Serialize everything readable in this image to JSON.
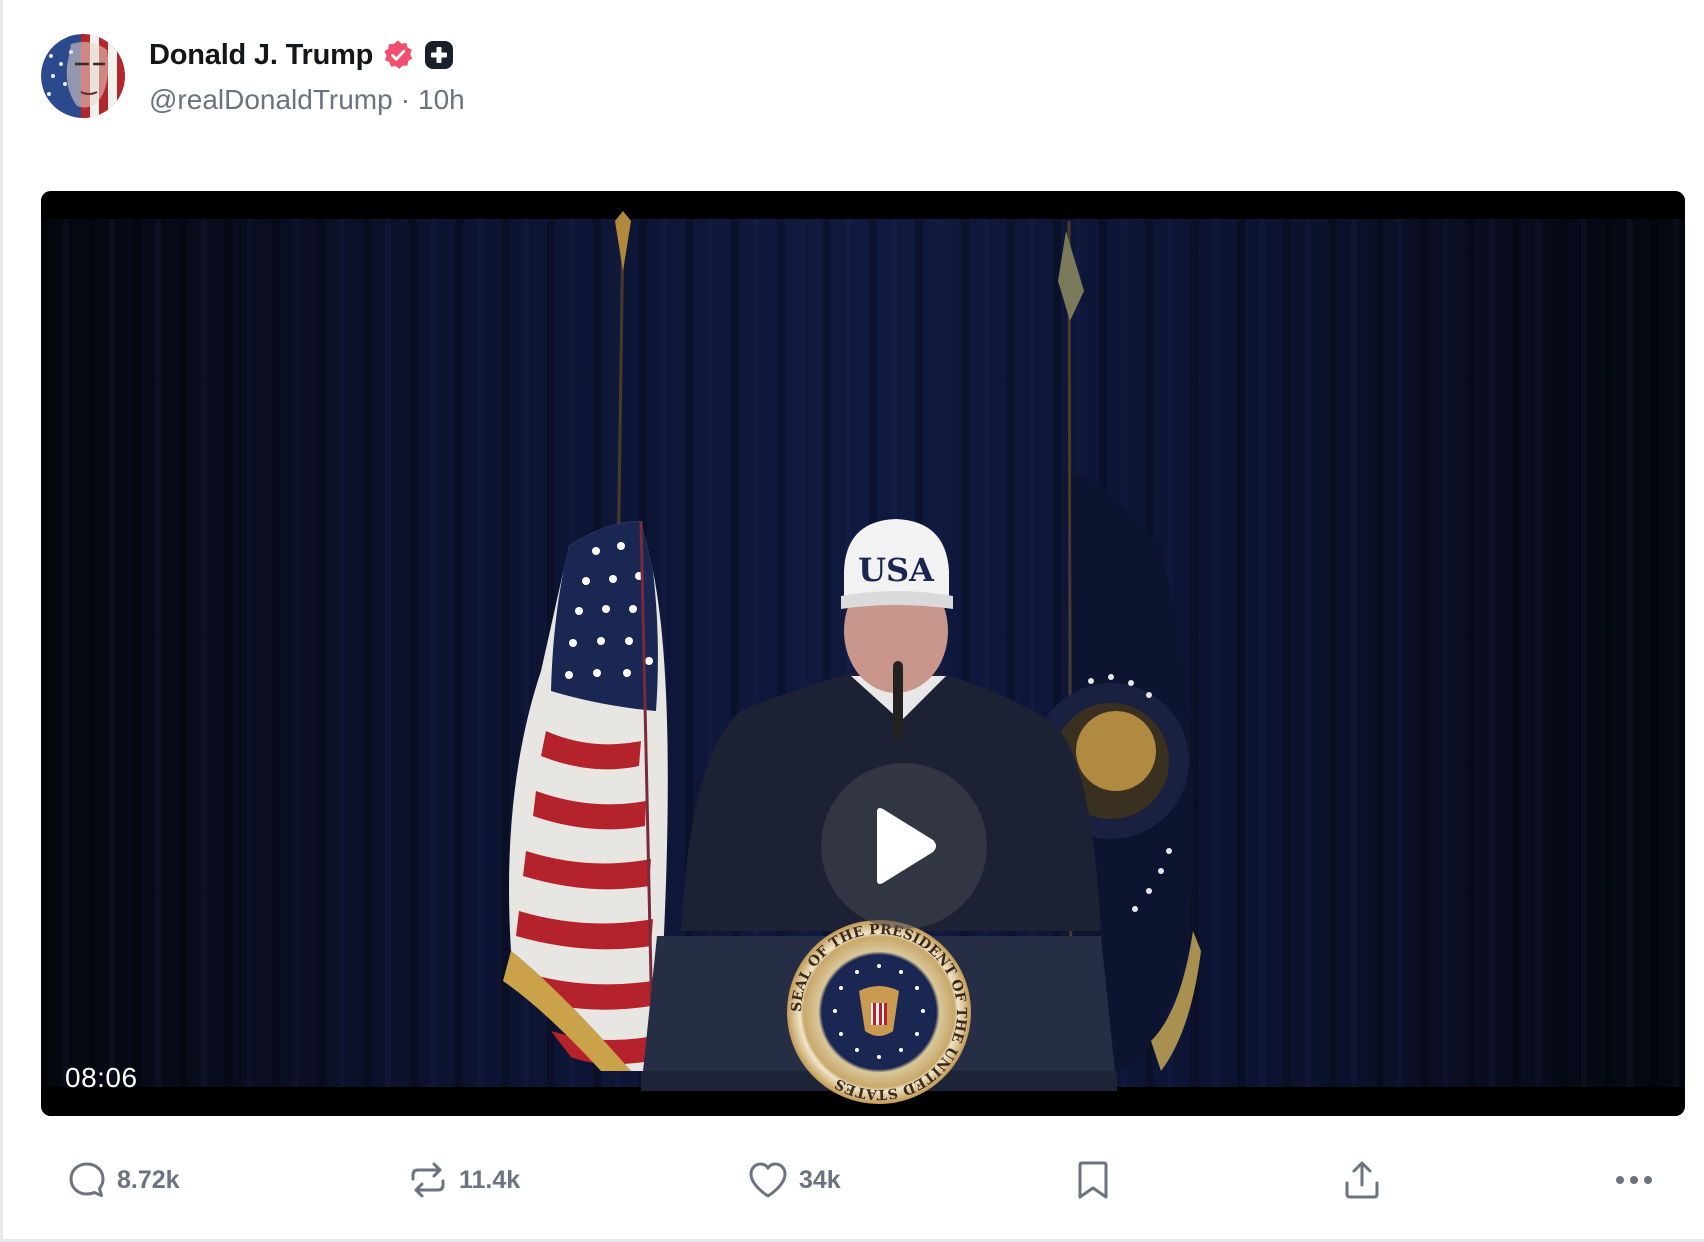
{
  "author": {
    "display_name": "Donald J. Trump",
    "handle": "@realDonaldTrump",
    "separator": "·",
    "time_ago": "10h",
    "verified_badge_color": "#f0506e",
    "plus_badge_color": "#1a1f2c"
  },
  "video": {
    "duration": "08:06",
    "cap_text": "USA",
    "seal_text": "SEAL OF THE PRESIDENT OF THE UNITED STATES",
    "play_icon": "play-icon"
  },
  "actions": {
    "replies": {
      "icon": "comment-icon",
      "count": "8.72k"
    },
    "retruths": {
      "icon": "retruth-icon",
      "count": "11.4k"
    },
    "likes": {
      "icon": "heart-icon",
      "count": "34k"
    },
    "bookmark": {
      "icon": "bookmark-icon"
    },
    "share": {
      "icon": "share-icon"
    },
    "more": {
      "icon": "more-icon"
    }
  },
  "colors": {
    "icon_gray": "#6b7280",
    "text_dark": "#14171a",
    "border": "#e6e8eb"
  }
}
